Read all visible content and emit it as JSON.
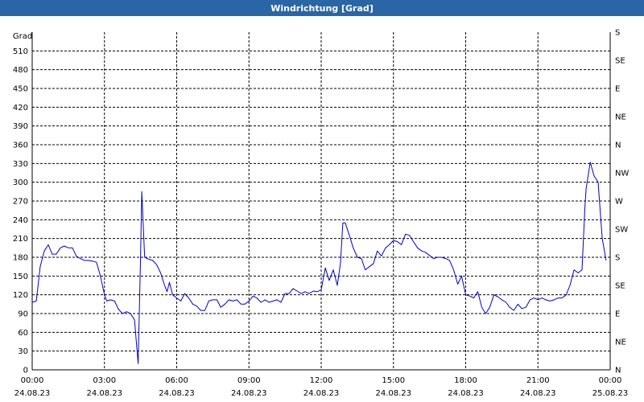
{
  "window": {
    "title": "Windrichtung [Grad]"
  },
  "chart_data": {
    "type": "line",
    "ylabel": "Grad",
    "ylim": [
      0,
      540
    ],
    "xlim": [
      "24.08.23 00:00",
      "25.08.23 00:00"
    ],
    "grid": true,
    "y_ticks": [
      0,
      30,
      60,
      90,
      120,
      150,
      180,
      210,
      240,
      270,
      300,
      330,
      360,
      390,
      420,
      450,
      480,
      510
    ],
    "right_ticks": [
      {
        "value": 0,
        "label": "N"
      },
      {
        "value": 45,
        "label": "NE"
      },
      {
        "value": 90,
        "label": "E"
      },
      {
        "value": 135,
        "label": "SE"
      },
      {
        "value": 180,
        "label": "S"
      },
      {
        "value": 225,
        "label": "SW"
      },
      {
        "value": 270,
        "label": "W"
      },
      {
        "value": 315,
        "label": "NW"
      },
      {
        "value": 360,
        "label": "N"
      },
      {
        "value": 405,
        "label": "NE"
      },
      {
        "value": 450,
        "label": "E"
      },
      {
        "value": 495,
        "label": "SE"
      },
      {
        "value": 540,
        "label": "S"
      }
    ],
    "x_ticks": [
      {
        "hour": 0,
        "time": "00:00",
        "date": "24.08.23"
      },
      {
        "hour": 3,
        "time": "03:00",
        "date": "24.08.23"
      },
      {
        "hour": 6,
        "time": "06:00",
        "date": "24.08.23"
      },
      {
        "hour": 9,
        "time": "09:00",
        "date": "24.08.23"
      },
      {
        "hour": 12,
        "time": "12:00",
        "date": "24.08.23"
      },
      {
        "hour": 15,
        "time": "15:00",
        "date": "24.08.23"
      },
      {
        "hour": 18,
        "time": "18:00",
        "date": "24.08.23"
      },
      {
        "hour": 21,
        "time": "21:00",
        "date": "24.08.23"
      },
      {
        "hour": 24,
        "time": "00:00",
        "date": "25.08.23"
      }
    ],
    "series": [
      {
        "color": "#0000cc",
        "points": [
          [
            0.0,
            108
          ],
          [
            0.17,
            110
          ],
          [
            0.33,
            165
          ],
          [
            0.5,
            190
          ],
          [
            0.67,
            200
          ],
          [
            0.83,
            185
          ],
          [
            1.0,
            185
          ],
          [
            1.17,
            195
          ],
          [
            1.33,
            198
          ],
          [
            1.5,
            195
          ],
          [
            1.67,
            195
          ],
          [
            1.83,
            182
          ],
          [
            2.0,
            178
          ],
          [
            2.17,
            175
          ],
          [
            2.33,
            175
          ],
          [
            2.5,
            174
          ],
          [
            2.67,
            172
          ],
          [
            2.83,
            150
          ],
          [
            3.0,
            120
          ],
          [
            3.1,
            110
          ],
          [
            3.25,
            112
          ],
          [
            3.42,
            110
          ],
          [
            3.58,
            97
          ],
          [
            3.75,
            90
          ],
          [
            3.92,
            93
          ],
          [
            4.08,
            90
          ],
          [
            4.25,
            80
          ],
          [
            4.4,
            10
          ],
          [
            4.5,
            180
          ],
          [
            4.55,
            285
          ],
          [
            4.67,
            180
          ],
          [
            4.83,
            177
          ],
          [
            5.0,
            175
          ],
          [
            5.17,
            168
          ],
          [
            5.33,
            155
          ],
          [
            5.5,
            135
          ],
          [
            5.6,
            125
          ],
          [
            5.7,
            140
          ],
          [
            5.83,
            120
          ],
          [
            6.0,
            115
          ],
          [
            6.17,
            110
          ],
          [
            6.33,
            122
          ],
          [
            6.5,
            115
          ],
          [
            6.67,
            105
          ],
          [
            6.83,
            102
          ],
          [
            7.0,
            95
          ],
          [
            7.17,
            95
          ],
          [
            7.33,
            110
          ],
          [
            7.5,
            112
          ],
          [
            7.67,
            112
          ],
          [
            7.83,
            100
          ],
          [
            8.0,
            105
          ],
          [
            8.17,
            112
          ],
          [
            8.33,
            110
          ],
          [
            8.5,
            112
          ],
          [
            8.67,
            105
          ],
          [
            8.83,
            105
          ],
          [
            9.0,
            110
          ],
          [
            9.17,
            118
          ],
          [
            9.33,
            115
          ],
          [
            9.5,
            108
          ],
          [
            9.67,
            112
          ],
          [
            9.83,
            108
          ],
          [
            10.0,
            110
          ],
          [
            10.17,
            112
          ],
          [
            10.33,
            108
          ],
          [
            10.5,
            122
          ],
          [
            10.67,
            122
          ],
          [
            10.83,
            130
          ],
          [
            11.0,
            126
          ],
          [
            11.17,
            122
          ],
          [
            11.33,
            125
          ],
          [
            11.5,
            122
          ],
          [
            11.67,
            126
          ],
          [
            11.83,
            125
          ],
          [
            12.0,
            128
          ],
          [
            12.17,
            163
          ],
          [
            12.33,
            143
          ],
          [
            12.5,
            160
          ],
          [
            12.67,
            135
          ],
          [
            12.8,
            170
          ],
          [
            12.9,
            235
          ],
          [
            13.0,
            235
          ],
          [
            13.17,
            215
          ],
          [
            13.33,
            195
          ],
          [
            13.5,
            180
          ],
          [
            13.67,
            178
          ],
          [
            13.83,
            160
          ],
          [
            14.0,
            165
          ],
          [
            14.17,
            170
          ],
          [
            14.33,
            190
          ],
          [
            14.5,
            182
          ],
          [
            14.67,
            195
          ],
          [
            14.83,
            200
          ],
          [
            15.0,
            207
          ],
          [
            15.17,
            205
          ],
          [
            15.33,
            200
          ],
          [
            15.5,
            217
          ],
          [
            15.67,
            215
          ],
          [
            15.83,
            205
          ],
          [
            16.0,
            195
          ],
          [
            16.17,
            190
          ],
          [
            16.33,
            188
          ],
          [
            16.5,
            183
          ],
          [
            16.67,
            178
          ],
          [
            16.83,
            180
          ],
          [
            17.0,
            180
          ],
          [
            17.17,
            178
          ],
          [
            17.33,
            175
          ],
          [
            17.5,
            160
          ],
          [
            17.67,
            137
          ],
          [
            17.83,
            150
          ],
          [
            18.0,
            120
          ],
          [
            18.17,
            118
          ],
          [
            18.33,
            115
          ],
          [
            18.5,
            125
          ],
          [
            18.67,
            100
          ],
          [
            18.83,
            90
          ],
          [
            19.0,
            100
          ],
          [
            19.17,
            120
          ],
          [
            19.33,
            117
          ],
          [
            19.5,
            112
          ],
          [
            19.67,
            108
          ],
          [
            19.83,
            100
          ],
          [
            20.0,
            95
          ],
          [
            20.17,
            105
          ],
          [
            20.33,
            98
          ],
          [
            20.5,
            100
          ],
          [
            20.67,
            112
          ],
          [
            20.83,
            115
          ],
          [
            21.0,
            112
          ],
          [
            21.17,
            115
          ],
          [
            21.33,
            112
          ],
          [
            21.5,
            110
          ],
          [
            21.67,
            112
          ],
          [
            21.83,
            115
          ],
          [
            22.0,
            115
          ],
          [
            22.17,
            120
          ],
          [
            22.33,
            135
          ],
          [
            22.5,
            160
          ],
          [
            22.67,
            155
          ],
          [
            22.83,
            160
          ],
          [
            22.95,
            260
          ],
          [
            23.0,
            290
          ],
          [
            23.17,
            332
          ],
          [
            23.33,
            310
          ],
          [
            23.5,
            300
          ],
          [
            23.67,
            210
          ],
          [
            23.83,
            175
          ]
        ]
      }
    ]
  }
}
